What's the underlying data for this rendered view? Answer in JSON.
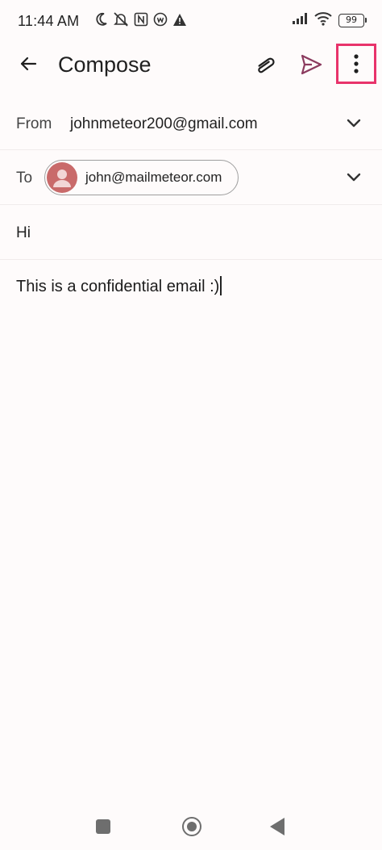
{
  "status_bar": {
    "time": "11:44 AM",
    "left_icons": [
      "moon-icon",
      "mute-icon",
      "nfc-icon",
      "app-notification-icon",
      "warning-icon"
    ],
    "right_icons": [
      "signal-icon",
      "wifi-icon"
    ],
    "battery": "99"
  },
  "app_bar": {
    "title": "Compose",
    "back_icon": "arrow-back-icon",
    "attach_icon": "paperclip-icon",
    "send_icon": "send-icon",
    "more_icon": "more-vert-icon",
    "highlight_color": "#e8336b"
  },
  "compose": {
    "from_label": "From",
    "from_value": "johnmeteor200@gmail.com",
    "to_label": "To",
    "to_recipient": "john@mailmeteor.com",
    "subject": "Hi",
    "body": "This is a confidential email :)"
  },
  "colors": {
    "background": "#fefbfb",
    "avatar": "#c96a6a",
    "send_accent": "#8b3a5e"
  },
  "nav_bar": {
    "icons": [
      "recents-icon",
      "home-icon",
      "back-icon"
    ]
  }
}
